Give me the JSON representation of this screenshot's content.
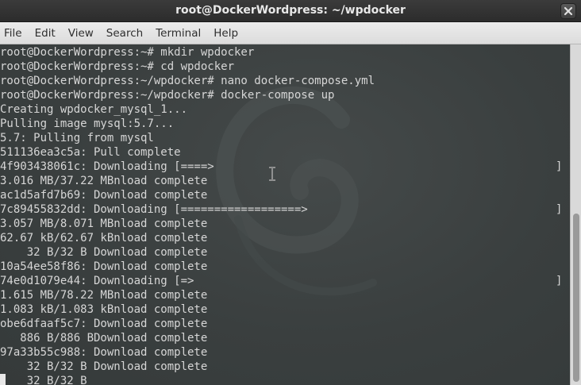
{
  "window": {
    "title": "root@DockerWordpress: ~/wpdocker"
  },
  "menubar": {
    "items": [
      "File",
      "Edit",
      "View",
      "Search",
      "Terminal",
      "Help"
    ]
  },
  "terminal": {
    "lines": [
      "root@DockerWordpress:~# mkdir wpdocker",
      "root@DockerWordpress:~# cd wpdocker",
      "root@DockerWordpress:~/wpdocker# nano docker-compose.yml",
      "root@DockerWordpress:~/wpdocker# docker-compose up",
      "Creating wpdocker_mysql_1...",
      "Pulling image mysql:5.7...",
      "5.7: Pulling from mysql",
      "511136ea3c5a: Pull complete",
      "4f903438061c: Downloading [====>",
      "3.016 MB/37.22 MBnload complete",
      "ac1d5afd7b69: Download complete",
      "7c89455832dd: Downloading [==================>",
      "3.057 MB/8.071 MBnload complete",
      "62.67 kB/62.67 kBnload complete",
      "    32 B/32 B Download complete",
      "10a54ee58f86: Download complete",
      "74e0d1079e44: Downloading [=>",
      "1.615 MB/78.22 MBnload complete",
      "1.083 kB/1.083 kBnload complete",
      "obe6dfaaf5c7: Download complete",
      "   886 B/886 BDownload complete",
      "97a33b55c988: Download complete",
      "    32 B/32 B Download complete",
      "    32 B/32 B"
    ],
    "progress_closers": [
      {
        "line": 8,
        "text": "]"
      },
      {
        "line": 11,
        "text": "]"
      },
      {
        "line": 16,
        "text": "]"
      }
    ]
  }
}
